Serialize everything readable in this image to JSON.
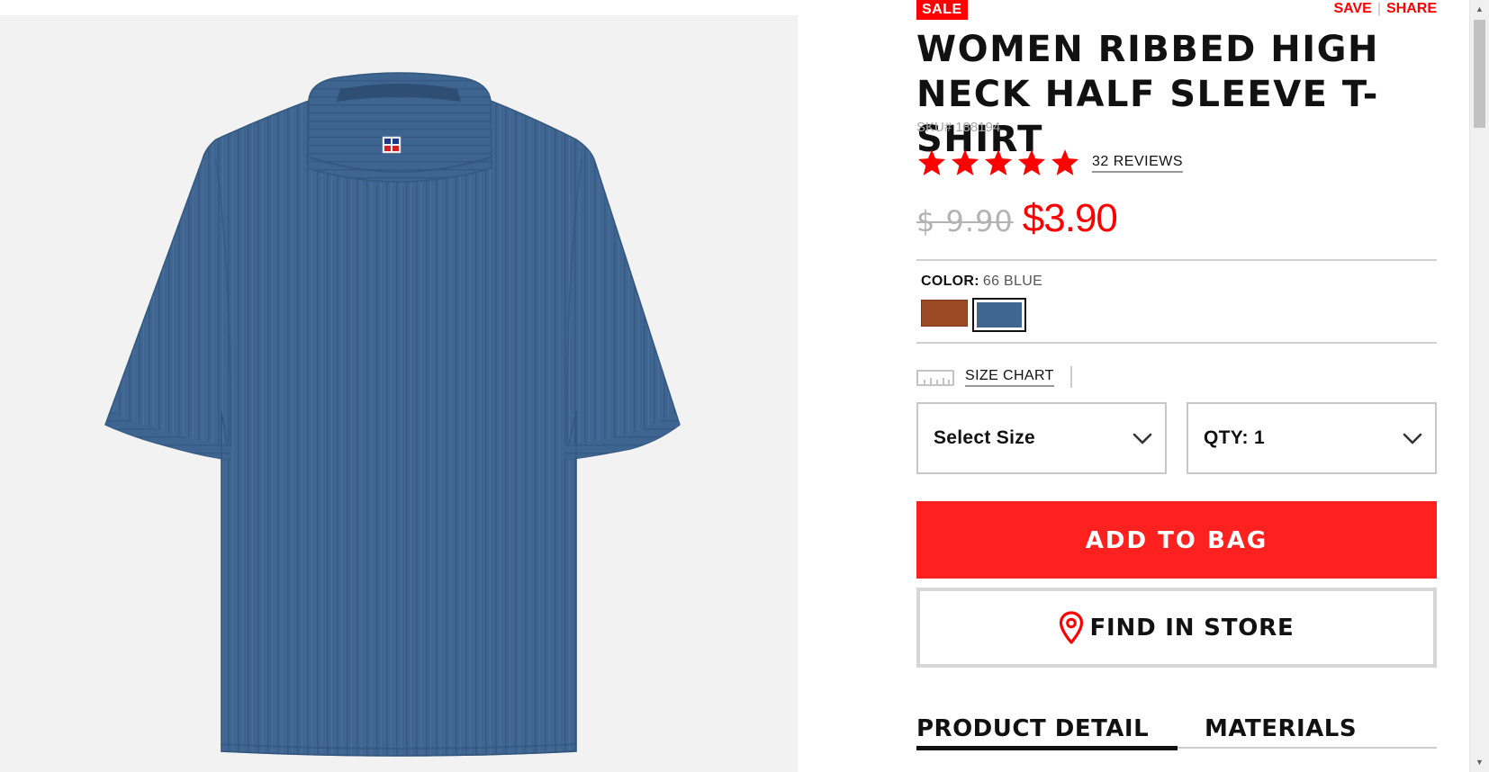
{
  "product": {
    "badge": "SALE",
    "title": "WOMEN RIBBED HIGH NECK HALF SLEEVE T-SHIRT",
    "sku_label": "SKU#",
    "sku": "188194",
    "rating_stars": 5,
    "reviews_label": "32 REVIEWS",
    "old_price": "$ 9.90",
    "price": "$3.90",
    "image_icon": "ribbed-tshirt-image"
  },
  "actions": {
    "save": "SAVE",
    "separator": "|",
    "share": "SHARE"
  },
  "color": {
    "label": "COLOR:",
    "selected": "66 BLUE",
    "swatches": [
      {
        "name": "brown",
        "hex": "#9c4a26"
      },
      {
        "name": "blue",
        "hex": "#3f6590"
      }
    ]
  },
  "size_chart": {
    "label": "SIZE CHART",
    "icon": "ruler-icon"
  },
  "selectors": {
    "size": "Select Size",
    "qty": "QTY: 1"
  },
  "buttons": {
    "add_to_bag": "ADD TO BAG",
    "find_in_store": "FIND IN STORE"
  },
  "tabs": [
    {
      "label": "PRODUCT DETAIL",
      "active": true
    },
    {
      "label": "MATERIALS",
      "active": false
    }
  ],
  "colors": {
    "accent_red": "#ff0000",
    "button_red": "#ff2020",
    "text": "#111111",
    "image_background": "#f2f2f2",
    "shirt_blue": "#3f6590"
  }
}
